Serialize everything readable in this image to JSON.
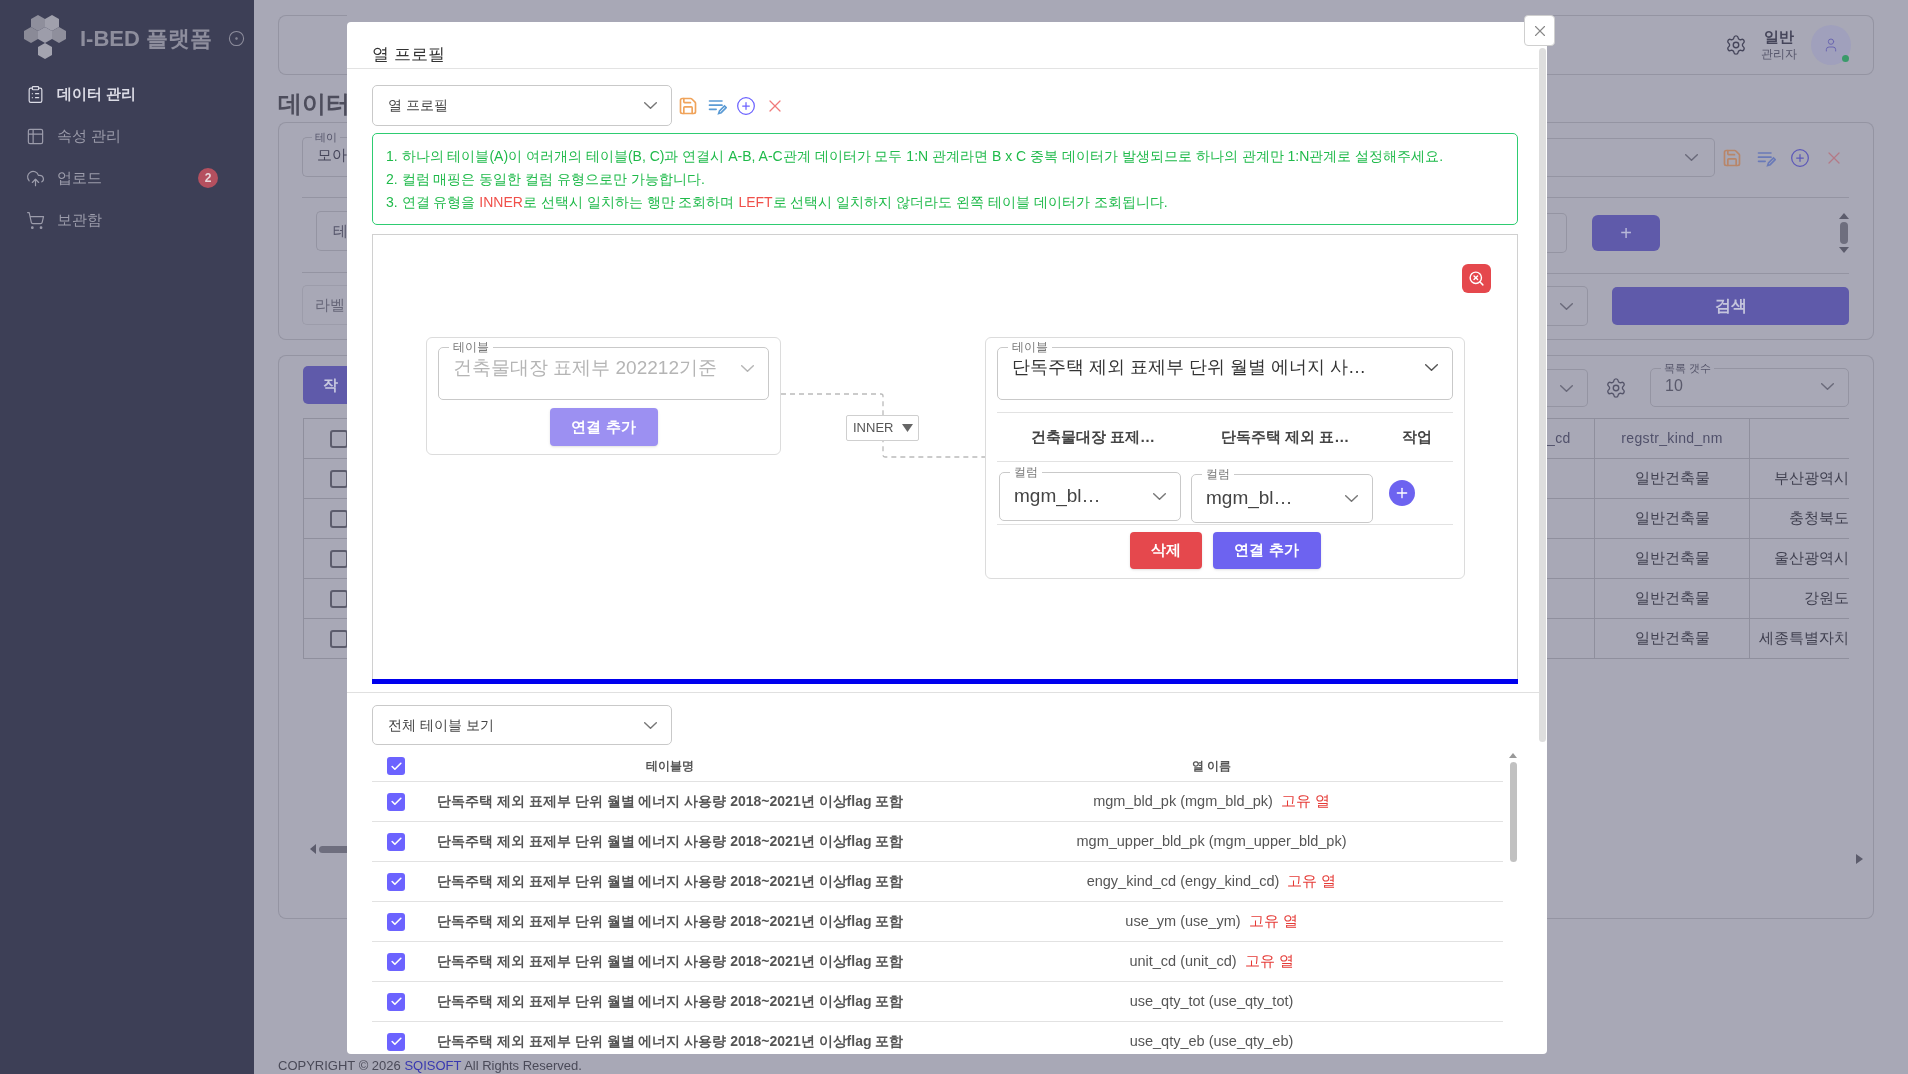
{
  "sidebar": {
    "brand": "I-BED 플랫폼",
    "items": [
      {
        "label": "데이터 관리",
        "selected": true
      },
      {
        "label": "속성 관리",
        "selected": false
      },
      {
        "label": "업로드",
        "selected": false,
        "badge": "2"
      },
      {
        "label": "보관함",
        "selected": false
      }
    ]
  },
  "background": {
    "page_title": "데이터",
    "user": {
      "name": "일반",
      "role": "관리자"
    },
    "search_panel": {
      "table_label": "테이",
      "table_value": "모아",
      "filter_field": "테",
      "label_placeholder": "라벨",
      "add_button": "+",
      "search_button": "검색"
    },
    "results": {
      "action_button": "작",
      "page_size_label": "목록 갯수",
      "page_size": "10",
      "select_all_checked": false,
      "columns": [
        "_cd",
        "regstr_kind_nm"
      ],
      "rows": [
        {
          "checked": false,
          "cells": [
            "",
            "일반건축물",
            "부산광역시"
          ]
        },
        {
          "checked": false,
          "cells": [
            "",
            "일반건축물",
            "충청북도"
          ]
        },
        {
          "checked": false,
          "cells": [
            "",
            "일반건축물",
            "울산광역시"
          ]
        },
        {
          "checked": false,
          "cells": [
            "",
            "일반건축물",
            "강원도"
          ]
        },
        {
          "checked": false,
          "cells": [
            "",
            "일반건축물",
            "세종특별자치"
          ]
        }
      ]
    }
  },
  "modal": {
    "title": "열 프로필",
    "profile_select": "열 프로필",
    "notice": [
      [
        {
          "text": "1. 하나의 테이블(A)이 여러개의 테이블(B, C)과 연결시 A-B, A-C관계 데이터가 모두 1:N 관계라면 B x C 중복 데이터가 발생되므로 하나의 관계만 1:N관계로 설정해주세요.",
          "highlight": false
        }
      ],
      [
        {
          "text": "2. 컬럼 매핑은 동일한 컬럼 유형으로만 가능합니다.",
          "highlight": false
        }
      ],
      [
        {
          "text": "3. 연결 유형을 ",
          "highlight": false
        },
        {
          "text": "INNER",
          "highlight": true
        },
        {
          "text": "로 선택시 일치하는 행만 조회하며 ",
          "highlight": false
        },
        {
          "text": "LEFT",
          "highlight": true
        },
        {
          "text": "로 선택시 일치하지 않더라도 왼쪽 테이블 데이터가 조회됩니다.",
          "highlight": false
        }
      ]
    ],
    "diagram": {
      "left_node": {
        "label": "테이블",
        "value": "건축물대장 표제부 202212기준",
        "disabled": true,
        "add_button": "연결 추가"
      },
      "join_type": "INNER",
      "right_node": {
        "label": "테이블",
        "value": "단독주택 제외 표제부 단위 월별 에너지 사…",
        "disabled": false,
        "headers": [
          "건축물대장 표제…",
          "단독주택 제외 표…",
          "작업"
        ],
        "mappings": [
          {
            "left": {
              "label": "컬럼",
              "value": "mgm_bl…"
            },
            "right": {
              "label": "컬럼",
              "value": "mgm_bl…"
            }
          }
        ],
        "delete_button": "삭제",
        "add_button": "연결 추가"
      }
    },
    "table_filter": "전체 테이블 보기",
    "columns": [
      "테이블명",
      "열 이름"
    ],
    "select_all_checked": true,
    "rows": [
      {
        "checked": true,
        "table_name": "단독주택 제외 표제부 단위 월별 에너지 사용량 2018~2021년 이상flag 포함",
        "column_name": "mgm_bld_pk (mgm_bld_pk)",
        "tag": "고유 열"
      },
      {
        "checked": true,
        "table_name": "단독주택 제외 표제부 단위 월별 에너지 사용량 2018~2021년 이상flag 포함",
        "column_name": "mgm_upper_bld_pk (mgm_upper_bld_pk)"
      },
      {
        "checked": true,
        "table_name": "단독주택 제외 표제부 단위 월별 에너지 사용량 2018~2021년 이상flag 포함",
        "column_name": "engy_kind_cd (engy_kind_cd)",
        "tag": "고유 열"
      },
      {
        "checked": true,
        "table_name": "단독주택 제외 표제부 단위 월별 에너지 사용량 2018~2021년 이상flag 포함",
        "column_name": "use_ym (use_ym)",
        "tag": "고유 열"
      },
      {
        "checked": true,
        "table_name": "단독주택 제외 표제부 단위 월별 에너지 사용량 2018~2021년 이상flag 포함",
        "column_name": "unit_cd (unit_cd)",
        "tag": "고유 열"
      },
      {
        "checked": true,
        "table_name": "단독주택 제외 표제부 단위 월별 에너지 사용량 2018~2021년 이상flag 포함",
        "column_name": "use_qty_tot (use_qty_tot)"
      },
      {
        "checked": true,
        "table_name": "단독주택 제외 표제부 단위 월별 에너지 사용량 2018~2021년 이상flag 포함",
        "column_name": "use_qty_eb (use_qty_eb)"
      }
    ]
  },
  "footer": {
    "prefix": "COPYRIGHT © 2026",
    "link": "SQISOFT",
    "suffix": "All Rights Reserved."
  }
}
